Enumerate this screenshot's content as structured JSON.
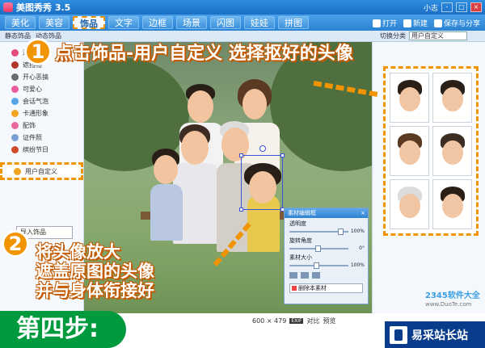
{
  "app": {
    "title": "美图秀秀 3.5",
    "user": "小志",
    "window_buttons": [
      "-",
      "□",
      "×"
    ]
  },
  "menu": {
    "tabs": [
      "美化",
      "美容",
      "饰品",
      "文字",
      "边框",
      "场景",
      "闪图",
      "娃娃",
      "拼图"
    ],
    "active_tab": "饰品",
    "actions": [
      "打开",
      "新建",
      "保存与分享"
    ]
  },
  "toolbar": {
    "items": [
      "静态饰品",
      "动态饰品"
    ],
    "category_label": "切换分类",
    "category_value": "用户自定义"
  },
  "sidebar": {
    "items": [
      "潮流涂鸦",
      "遮挡物",
      "开心恶搞",
      "可爱心",
      "会话气泡",
      "卡通形象",
      "配饰",
      "证件照",
      "缤纷节日"
    ],
    "colors": [
      "#e24b7a",
      "#b0362c",
      "#6b6b6b",
      "#ec5aa0",
      "#56a6e8",
      "#f2a521",
      "#e86a9d",
      "#7aa0d4",
      "#d24a2c"
    ],
    "active_item": "用户自定义",
    "extra_input": "导入饰品"
  },
  "steps": {
    "step1_number": "1",
    "step1_text": "点击饰品-用户自定义 选择抠好的头像",
    "step2_number": "2",
    "step2_lines": [
      "将头像放大",
      "遮盖原图的头像",
      "并与身体衔接好"
    ]
  },
  "dialog": {
    "title": "素材编辑框",
    "close": "×",
    "transparency_label": "透明度",
    "transparency_value": "100%",
    "rotation_label": "旋转角度",
    "rotation_value": "0°",
    "size_label": "素材大小",
    "size_value": "100%",
    "delete_label": "删除本素材"
  },
  "status": {
    "size": "600 × 479",
    "badge": "EXIF",
    "contrast": "对比",
    "preview": "预览"
  },
  "banner": {
    "text": "第四步:"
  },
  "watermark": {
    "text": "2345软件大全",
    "url": "www.DuoTe.com"
  },
  "logo": {
    "text": "易采站长站"
  },
  "colors": {
    "accent_orange": "#f29400",
    "title_blue": "#1a6fc5",
    "banner_green": "#009a3e"
  }
}
